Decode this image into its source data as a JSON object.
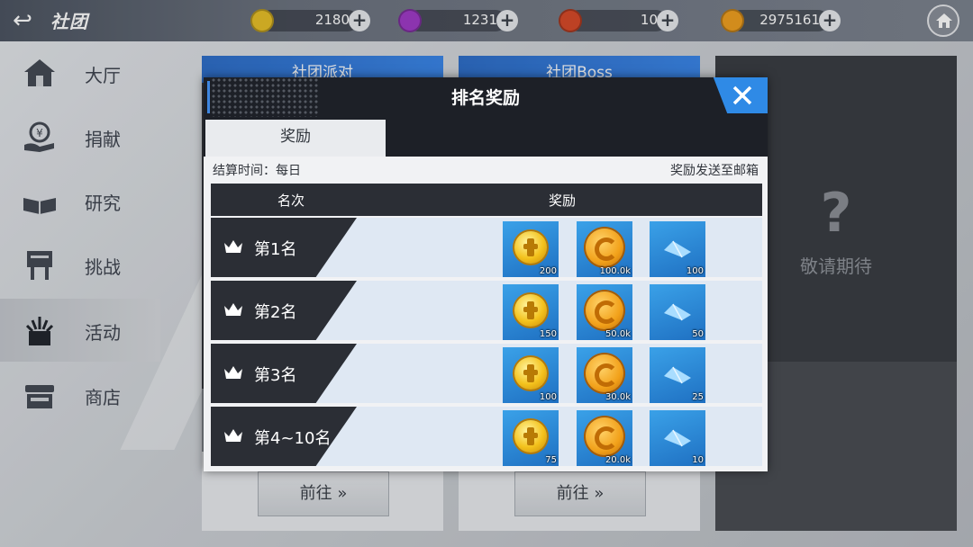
{
  "header": {
    "title": "社团",
    "resources": [
      {
        "name": "gold-token",
        "value": "2180",
        "color": "#e8c028"
      },
      {
        "name": "purple-gem",
        "value": "1231",
        "color": "#a03cc8"
      },
      {
        "name": "red-orb",
        "value": "10",
        "color": "#d84a2a"
      },
      {
        "name": "coin",
        "value": "2975161",
        "color": "#f0a020"
      }
    ]
  },
  "sidebar": {
    "items": [
      {
        "label": "大厅",
        "icon": "hall-icon"
      },
      {
        "label": "捐献",
        "icon": "donate-icon"
      },
      {
        "label": "研究",
        "icon": "research-icon"
      },
      {
        "label": "挑战",
        "icon": "challenge-icon"
      },
      {
        "label": "活动",
        "icon": "event-icon",
        "active": true
      },
      {
        "label": "商店",
        "icon": "shop-icon"
      }
    ]
  },
  "cards": {
    "party_title": "社团派对",
    "boss_title": "社团Boss",
    "goto_label": "前往",
    "coming_soon": "敬请期待"
  },
  "modal": {
    "title": "排名奖励",
    "tab_label": "奖励",
    "settle_text": "结算时间：每日",
    "mail_text": "奖励发送至邮箱",
    "col_rank": "名次",
    "col_reward": "奖励",
    "rows": [
      {
        "rank": "第1名",
        "rewards": [
          "200",
          "100.0k",
          "100"
        ]
      },
      {
        "rank": "第2名",
        "rewards": [
          "150",
          "50.0k",
          "50"
        ]
      },
      {
        "rank": "第3名",
        "rewards": [
          "100",
          "30.0k",
          "25"
        ]
      },
      {
        "rank": "第4~10名",
        "rewards": [
          "75",
          "20.0k",
          "10"
        ]
      }
    ]
  }
}
